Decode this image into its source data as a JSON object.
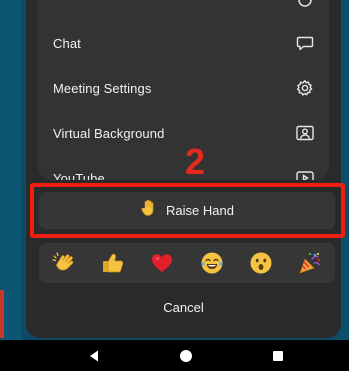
{
  "menu": {
    "items": [
      {
        "label": "Chat",
        "icon": "chat-bubble-icon"
      },
      {
        "label": "Meeting Settings",
        "icon": "gear-icon"
      },
      {
        "label": "Virtual Background",
        "icon": "portrait-icon"
      },
      {
        "label": "YouTube",
        "icon": "youtube-icon"
      }
    ]
  },
  "annotation": {
    "number": "2",
    "color": "#f01e12"
  },
  "raise_hand": {
    "label": "Raise Hand",
    "icon": "raised-hand-icon"
  },
  "reactions": [
    {
      "name": "clapping-hands-icon"
    },
    {
      "name": "thumbs-up-icon"
    },
    {
      "name": "red-heart-icon"
    },
    {
      "name": "tears-of-joy-icon"
    },
    {
      "name": "surprised-face-icon"
    },
    {
      "name": "party-popper-icon"
    }
  ],
  "cancel": {
    "label": "Cancel"
  },
  "navbar": {
    "buttons": [
      {
        "name": "back-icon"
      },
      {
        "name": "home-icon"
      },
      {
        "name": "recents-icon"
      }
    ]
  },
  "colors": {
    "sheet": "#2a2a2a",
    "card": "#333333",
    "backdrop": "#0f4a63",
    "text": "#f2f2f2"
  }
}
